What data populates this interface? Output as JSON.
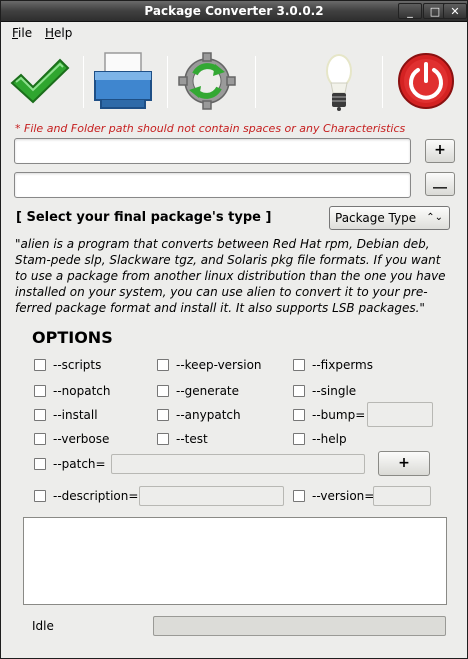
{
  "window": {
    "title": "Package Converter 3.0.0.2",
    "controls": {
      "minimize": "_",
      "maximize": "□",
      "close": "✕"
    }
  },
  "menu": {
    "file": {
      "mnemonic": "F",
      "rest": "ile"
    },
    "help": {
      "mnemonic": "H",
      "rest": "elp"
    }
  },
  "toolbar": [
    {
      "name": "convert",
      "icon": "checkmark-icon"
    },
    {
      "name": "open",
      "icon": "printer-icon"
    },
    {
      "name": "refresh",
      "icon": "refresh-gear-icon"
    },
    {
      "name": "tip",
      "icon": "lightbulb-icon"
    },
    {
      "name": "quit",
      "icon": "power-icon"
    }
  ],
  "warning": "* File and Folder path should not contain spaces or any Characteristics",
  "inputs": {
    "path1": "",
    "path2": ""
  },
  "buttons": {
    "add_file": "+",
    "browse": "__",
    "add_patch": "+"
  },
  "select_label": "[ Select your final package's type ]",
  "package_type": {
    "selected": "Package Type",
    "arrows": "⌃⌄"
  },
  "description": "\"alien is a program that converts between Red Hat rpm, Debian deb, Stam-pede slp, Slackware tgz, and Solaris pkg file formats. If you want to use a package from another linux distribution than the one you have installed on your system, you can use alien to convert it to your pre-ferred package format and install it. It also supports LSB packages.\"",
  "options_heading": "OPTIONS",
  "options": {
    "scripts": "--scripts",
    "keep_version": "--keep-version",
    "fixperms": "--fixperms",
    "nopatch": "--nopatch",
    "generate": "--generate",
    "single": "--single",
    "install": "--install",
    "anypatch": "--anypatch",
    "bump": "--bump=",
    "verbose": "--verbose",
    "test": "--test",
    "help": "--help",
    "patch": "--patch=",
    "description": "--description=",
    "version": "--version="
  },
  "option_fields": {
    "bump": "",
    "patch": "",
    "description": "",
    "version": ""
  },
  "status": "Idle",
  "progress": 0,
  "colors": {
    "warning": "#c62020",
    "titlebar": "#404040"
  }
}
